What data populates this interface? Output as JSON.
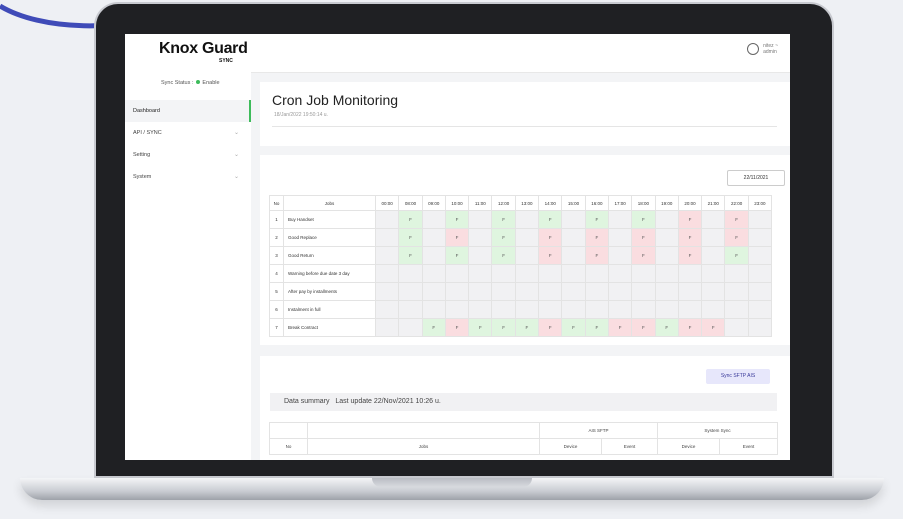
{
  "header": {
    "logo": "Knox Guard",
    "logo_sub": "SYNC",
    "user_name": "nitez ~",
    "user_role": "admin"
  },
  "sidebar": {
    "sync_label": "Sync Status :",
    "sync_value": "Enable",
    "items": [
      {
        "label": "Dashboard",
        "active": true
      },
      {
        "label": "API / SYNC"
      },
      {
        "label": "Setting"
      },
      {
        "label": "System"
      }
    ]
  },
  "monitor": {
    "title": "Cron Job Monitoring",
    "timestamp": "18/Jan/2022 19:50:14 u."
  },
  "schedule": {
    "date": "22/11/2021",
    "col_no": "No",
    "col_jobs": "Jobs",
    "hours": [
      "00:00",
      "08:00",
      "09:00",
      "10:00",
      "11:00",
      "12:00",
      "13:00",
      "14:00",
      "15:00",
      "16:00",
      "17:00",
      "18:00",
      "19:00",
      "20:00",
      "21:00",
      "22:00",
      "23:00"
    ],
    "rows": [
      {
        "no": "1",
        "job": "Buy Handset",
        "cells": [
          "",
          "F",
          "",
          "F",
          "",
          "F",
          "",
          "F",
          "",
          "F",
          "",
          "F",
          "",
          "F",
          "",
          "F",
          ""
        ],
        "status": [
          "",
          "ok",
          "",
          "ok",
          "",
          "ok",
          "",
          "ok",
          "",
          "ok",
          "",
          "ok",
          "",
          "fail",
          "",
          "fail",
          ""
        ]
      },
      {
        "no": "2",
        "job": "Good Replace",
        "cells": [
          "",
          "F",
          "",
          "F",
          "",
          "F",
          "",
          "F",
          "",
          "F",
          "",
          "F",
          "",
          "F",
          "",
          "F",
          ""
        ],
        "status": [
          "",
          "ok",
          "",
          "fail",
          "",
          "ok",
          "",
          "fail",
          "",
          "fail",
          "",
          "fail",
          "",
          "fail",
          "",
          "fail",
          ""
        ]
      },
      {
        "no": "3",
        "job": "Good Return",
        "cells": [
          "",
          "F",
          "",
          "F",
          "",
          "F",
          "",
          "F",
          "",
          "F",
          "",
          "F",
          "",
          "F",
          "",
          "F",
          ""
        ],
        "status": [
          "",
          "ok",
          "",
          "ok",
          "",
          "ok",
          "",
          "fail",
          "",
          "fail",
          "",
          "fail",
          "",
          "fail",
          "",
          "ok",
          ""
        ]
      },
      {
        "no": "4",
        "job": "Warning before due date 3 day",
        "cells": [
          "",
          "",
          "",
          "",
          "",
          "",
          "",
          "",
          "",
          "",
          "",
          "",
          "",
          "",
          "",
          "",
          ""
        ],
        "status": [
          "",
          "",
          "",
          "",
          "",
          "",
          "",
          "",
          "",
          "",
          "",
          "",
          "",
          "",
          "",
          "",
          ""
        ]
      },
      {
        "no": "5",
        "job": "After pay by installments",
        "cells": [
          "",
          "",
          "",
          "",
          "",
          "",
          "",
          "",
          "",
          "",
          "",
          "",
          "",
          "",
          "",
          "",
          ""
        ],
        "status": [
          "",
          "",
          "",
          "",
          "",
          "",
          "",
          "",
          "",
          "",
          "",
          "",
          "",
          "",
          "",
          "",
          ""
        ]
      },
      {
        "no": "6",
        "job": "Instalment in full",
        "cells": [
          "",
          "",
          "",
          "",
          "",
          "",
          "",
          "",
          "",
          "",
          "",
          "",
          "",
          "",
          "",
          "",
          ""
        ],
        "status": [
          "",
          "",
          "",
          "",
          "",
          "",
          "",
          "",
          "",
          "",
          "",
          "",
          "",
          "",
          "",
          "",
          ""
        ]
      },
      {
        "no": "7",
        "job": "Break Contract",
        "cells": [
          "",
          "",
          "F",
          "F",
          "F",
          "F",
          "F",
          "F",
          "F",
          "F",
          "F",
          "F",
          "F",
          "F",
          "F",
          "",
          ""
        ],
        "status": [
          "",
          "",
          "ok",
          "fail",
          "ok",
          "ok",
          "ok",
          "fail",
          "ok",
          "ok",
          "fail",
          "fail",
          "ok",
          "fail",
          "fail",
          "",
          ""
        ]
      }
    ]
  },
  "summary": {
    "button": "Sync SFTP AIS",
    "title": "Data summary",
    "last_update": "Last update 22/Nov/2021 10:26 u.",
    "col_no": "No",
    "col_jobs": "Jobs",
    "group_ais": "AIS SFTP",
    "group_sys": "System Sync",
    "col_device": "Device",
    "col_event": "Event"
  },
  "colors": {
    "accent": "#3dbb5b",
    "ok": "#dff5df",
    "fail": "#fadde0"
  }
}
